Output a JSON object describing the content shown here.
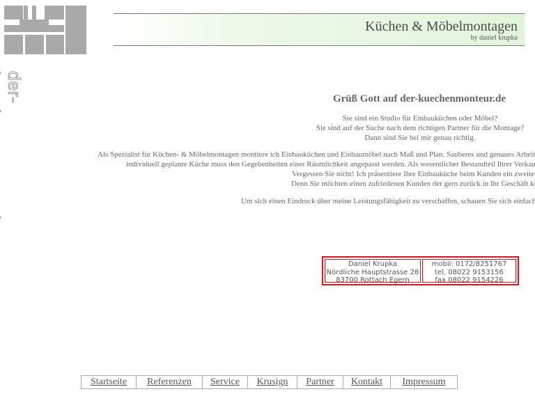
{
  "site": {
    "vertical_name": "der-kuechenmonteur.de"
  },
  "header": {
    "title": "Küchen & Möbelmontagen",
    "subtitle": "by daniel krupka"
  },
  "main": {
    "heading": "Grüß Gott auf der-kuechenmonteur.de",
    "intro": [
      "Sie sind ein Studio für Einbauküchen oder Möbel?",
      "Sie sind auf der Suche nach dem richtigen Partner für die Montage?",
      "Dann sind Sie bei mir genau richtig."
    ],
    "paragraph": [
      "Als Spezialist für Küchen- & Möbelmontagen montiere ich Einbauküchen und Einbaumöbel nach Maß und Plan. Sauberes und genaues Arbeiten",
      "individuell geplante Küche muss den Gegebenheiten einer Räumlichkeit angepasst werden. Als wesentlicher Bestandteil Ihrer Verkaufs",
      "Vergessen Sie nicht! Ich präsentiere Ihre Einbauküche beim Kunden ein zweites",
      "Denn Sie möchten einen zufriedenen Kunden der gern zurück in Ihr Geschäft kom"
    ],
    "more": "Um sich einen Eindruck über meine Leistungsfähigkeit zu verschaffen, schauen Sie sich einfach m"
  },
  "contact": {
    "name": "Daniel Krupka",
    "street": "Nördliche Hauptstrasse 28",
    "city": "83700 Rottach Egern",
    "mobile": "mobil: 0172/8251767",
    "phone": "tel. 08022 9153156",
    "fax": "fax  08022 9154226"
  },
  "nav": {
    "items": [
      "Startseite",
      "Referenzen",
      "Service",
      "Krusign",
      "Partner",
      "Kontakt",
      "Impressum"
    ]
  },
  "colors": {
    "accent_border": "#d8141e",
    "logo_gray": "#a9a9a9",
    "banner_green": "#e3f4dc"
  }
}
